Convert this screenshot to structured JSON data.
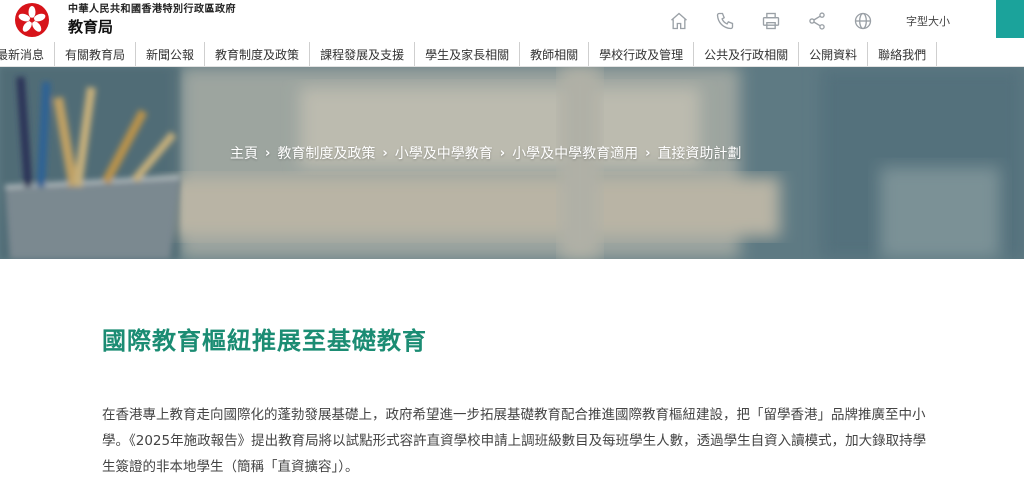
{
  "header": {
    "gov_name": "中華人民共和國香港特別行政區政府",
    "bureau_name": "教育局",
    "font_size_label": "字型大小",
    "accent_color": "#1ba39b",
    "tools": [
      "home-icon",
      "phone-icon",
      "print-icon",
      "share-icon",
      "globe-icon"
    ]
  },
  "nav": {
    "items": [
      "最新消息",
      "有關教育局",
      "新聞公報",
      "教育制度及政策",
      "課程發展及支援",
      "學生及家長相關",
      "教師相關",
      "學校行政及管理",
      "公共及行政相關",
      "公開資料",
      "聯絡我們"
    ]
  },
  "breadcrumb": [
    "主頁",
    "教育制度及政策",
    "小學及中學教育",
    "小學及中學教育適用",
    "直接資助計劃"
  ],
  "main": {
    "title": "國際教育樞紐推展至基礎教育",
    "title_color": "#1b8c73",
    "paragraph": "在香港專上教育走向國際化的蓬勃發展基礎上，政府希望進一步拓展基礎教育配合推進國際教育樞紐建設，把「留學香港」品牌推廣至中小學。《2025年施政報告》提出教育局將以試點形式容許直資學校申請上調班級數目及每班學生人數，透過學生自資入讀模式，加大錄取持學生簽證的非本地學生（簡稱「直資擴容」）。"
  }
}
